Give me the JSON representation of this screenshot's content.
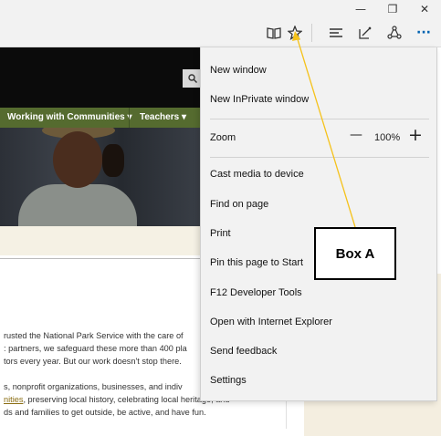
{
  "window_controls": {
    "minimize": "—",
    "maximize": "❐",
    "close": "✕"
  },
  "toolbar": {
    "reading_view_icon": "book-icon",
    "favorites_icon": "star-icon",
    "hub_icon": "hub-icon",
    "note_icon": "pen-icon",
    "share_icon": "share-icon",
    "more_label": "···"
  },
  "page": {
    "nav": [
      "Working with Communities ▾",
      "Teachers ▾"
    ],
    "paragraph1": [
      "rusted the National Park Service with the care of",
      ": partners, we safeguard these more than 400 pla",
      "tors every year. But our work doesn't stop there."
    ],
    "paragraph2": [
      "s, nonprofit organizations, businesses, and indiv",
      "nities",
      ", preserving local history, celebrating local heritage, and",
      "ds and families to get outside, be active, and have fun."
    ]
  },
  "menu": {
    "items": [
      "New window",
      "New InPrivate window",
      "Zoom",
      "Cast media to device",
      "Find on page",
      "Print",
      "Pin this page to Start",
      "F12 Developer Tools",
      "Open with Internet Explorer",
      "Send feedback",
      "Settings"
    ],
    "zoom": {
      "minus": "—",
      "value": "100%",
      "plus": "+"
    }
  },
  "annotation": {
    "label": "Box A",
    "arrow_color": "#f5c21b"
  },
  "colors": {
    "accent": "#0063b1",
    "nav_green": "#556b2f"
  }
}
